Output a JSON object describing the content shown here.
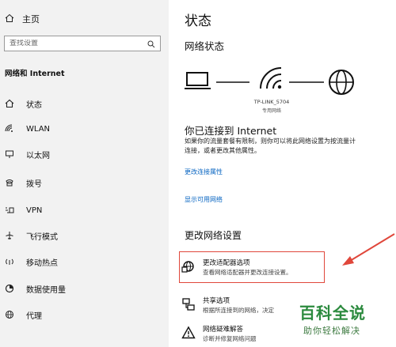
{
  "sidebar": {
    "home_label": "主页",
    "search_placeholder": "查找设置",
    "section_title": "网络和 Internet",
    "items": [
      {
        "label": "状态",
        "icon": "home-icon"
      },
      {
        "label": "WLAN",
        "icon": "wifi-icon"
      },
      {
        "label": "以太网",
        "icon": "ethernet-icon"
      },
      {
        "label": "拨号",
        "icon": "dialup-icon"
      },
      {
        "label": "VPN",
        "icon": "vpn-icon"
      },
      {
        "label": "飞行模式",
        "icon": "airplane-icon"
      },
      {
        "label": "移动热点",
        "icon": "hotspot-icon"
      },
      {
        "label": "数据使用量",
        "icon": "data-usage-icon"
      },
      {
        "label": "代理",
        "icon": "globe-icon"
      }
    ]
  },
  "main": {
    "title": "状态",
    "network_status_title": "网络状态",
    "ssid": "TP-LINK_5704",
    "network_type": "专用网络",
    "connected_title": "你已连接到 Internet",
    "connected_desc_line1": "如果你的流量套餐有限制，则你可以将此网络设置为按流量计",
    "connected_desc_line2": "连接，或者更改其他属性。",
    "link_change_props": "更改连接属性",
    "link_show_networks": "显示可用网络",
    "change_settings_title": "更改网络设置",
    "options": [
      {
        "title": "更改适配器选项",
        "desc": "查看网络适配器并更改连接设置。"
      },
      {
        "title": "共享选项",
        "desc": "根据所连接到的网络，决定"
      },
      {
        "title": "网络疑难解答",
        "desc": "诊断并修复网络问题"
      }
    ]
  },
  "watermark": {
    "main": "百科全说",
    "sub": "助你轻松解决"
  },
  "colors": {
    "link": "#0a66c2",
    "highlight": "#e0473b",
    "arrow": "#e0473b",
    "watermark": "#2b8a3e"
  }
}
